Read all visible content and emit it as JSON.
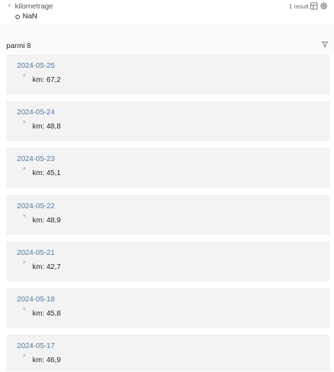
{
  "property": {
    "name": "kilometrage",
    "result_count": "1 result",
    "value": "NaN"
  },
  "icons": {
    "table": "table-icon",
    "settings": "gear-icon",
    "filter": "filter-icon"
  },
  "group": {
    "title": "parmi 8"
  },
  "entries": [
    {
      "date": "2024-05-25",
      "value": "km: 67,2"
    },
    {
      "date": "2024-05-24",
      "value": "km: 48,8"
    },
    {
      "date": "2024-05-23",
      "value": "km: 45,1"
    },
    {
      "date": "2024-05-22",
      "value": "km: 48,9"
    },
    {
      "date": "2024-05-21",
      "value": "km: 42,7"
    },
    {
      "date": "2024-05-18",
      "value": "km: 45,8"
    },
    {
      "date": "2024-05-17",
      "value": "km: 46,9"
    }
  ],
  "colors": {
    "link": "#4f78a0",
    "card_background": "#f3f3f3"
  }
}
